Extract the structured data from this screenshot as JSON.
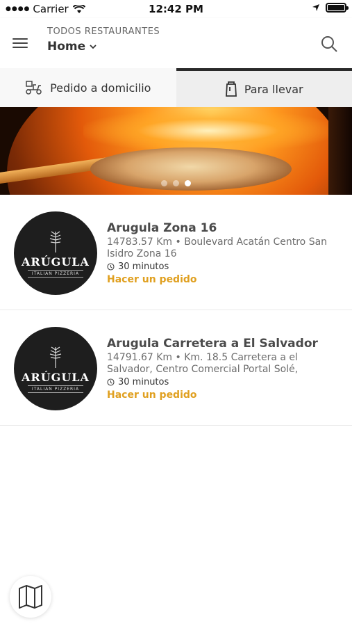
{
  "status_bar": {
    "carrier": "Carrier",
    "time": "12:42 PM"
  },
  "header": {
    "subtitle": "TODOS RESTAURANTES",
    "location": "Home",
    "icons": {
      "menu": "hamburger-menu-icon",
      "search": "search-icon",
      "location_dropdown": "chevron-down-icon"
    }
  },
  "tabs": [
    {
      "label": "Pedido a domicilio",
      "icon": "delivery-scooter-icon",
      "selected": false
    },
    {
      "label": "Para llevar",
      "icon": "takeaway-bag-icon",
      "selected": true
    }
  ],
  "banner": {
    "image": "pizza-oven-photo",
    "page_count": 3,
    "active_page": 3
  },
  "restaurants": [
    {
      "name": "Arugula Zona 16",
      "address": "14783.57 Km • Boulevard Acatán Centro San Isidro Zona 16",
      "time": "30 minutos",
      "action": "Hacer un pedido",
      "logo": {
        "name": "ARÚGULA",
        "tag": "ITALIAN PIZZERIA"
      }
    },
    {
      "name": "Arugula Carretera a El Salvador",
      "address": "14791.67 Km • Km. 18.5 Carretera a el Salvador, Centro Comercial Portal Solé,",
      "time": "30 minutos",
      "action": "Hacer un pedido",
      "logo": {
        "name": "ARÚGULA",
        "tag": "ITALIAN PIZZERIA"
      }
    }
  ],
  "map_button": {
    "icon": "map-icon"
  },
  "colors": {
    "accent_orange": "#e0a020",
    "tab_selected_border": "#2a2a2a",
    "logo_bg": "#1e1e1e"
  }
}
